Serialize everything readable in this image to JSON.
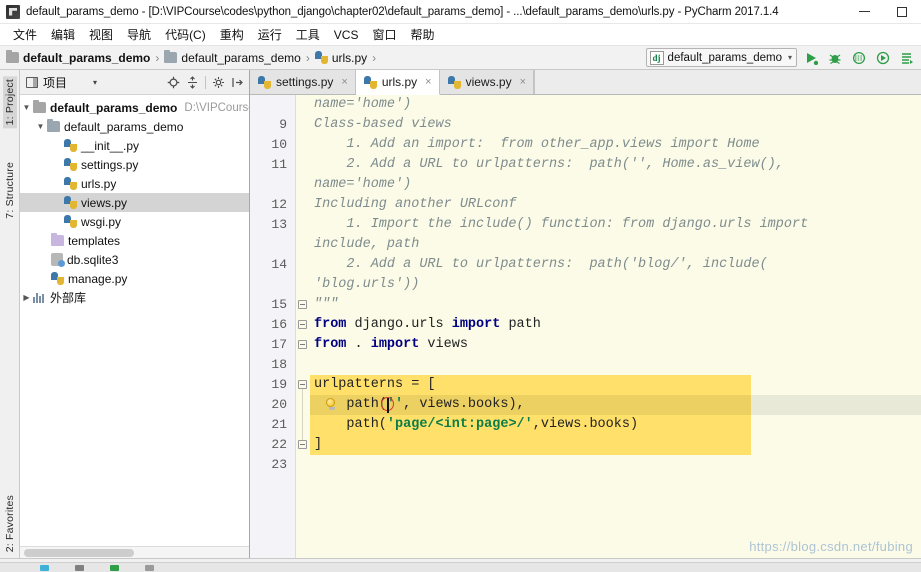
{
  "window": {
    "title": "default_params_demo - [D:\\VIPCourse\\codes\\python_django\\chapter02\\default_params_demo] - ...\\default_params_demo\\urls.py - PyCharm 2017.1.4",
    "app_icon": "pycharm-icon",
    "minimize_label": "–",
    "maximize_label": "□"
  },
  "menubar": {
    "items": [
      {
        "label": "文件",
        "name": "menu-file"
      },
      {
        "label": "编辑",
        "name": "menu-edit"
      },
      {
        "label": "视图",
        "name": "menu-view"
      },
      {
        "label": "导航",
        "name": "menu-navigate"
      },
      {
        "label": "代码(C)",
        "name": "menu-code"
      },
      {
        "label": "重构",
        "name": "menu-refactor"
      },
      {
        "label": "运行",
        "name": "menu-run"
      },
      {
        "label": "工具",
        "name": "menu-tools"
      },
      {
        "label": "VCS",
        "name": "menu-vcs"
      },
      {
        "label": "窗口",
        "name": "menu-window"
      },
      {
        "label": "帮助",
        "name": "menu-help"
      }
    ]
  },
  "breadcrumb": {
    "separator": "›",
    "items": [
      {
        "label": "default_params_demo",
        "icon": "folder-icon",
        "bold": true
      },
      {
        "label": "default_params_demo",
        "icon": "folder-icon",
        "bold": false
      },
      {
        "label": "urls.py",
        "icon": "python-file-icon",
        "bold": false
      }
    ]
  },
  "run_config": {
    "badge": "dj",
    "name": "default_params_demo",
    "caret": "▾",
    "buttons": [
      {
        "name": "run-button",
        "title": "Run"
      },
      {
        "name": "debug-button",
        "title": "Debug"
      },
      {
        "name": "coverage-button",
        "title": "Run with Coverage"
      },
      {
        "name": "profile-button",
        "title": "Profile"
      },
      {
        "name": "attach-button",
        "title": "Attach"
      }
    ]
  },
  "vertical_tabs": [
    {
      "label": "1: Project",
      "name": "vtab-project",
      "active": true
    },
    {
      "label": "7: Structure",
      "name": "vtab-structure",
      "active": false
    },
    {
      "label": "2: Favorites",
      "name": "vtab-favorites",
      "active": false
    }
  ],
  "project_panel": {
    "title": "项目",
    "caret": "▾",
    "tools": [
      {
        "name": "locate-icon",
        "glyph": "⊕"
      },
      {
        "name": "collapse-all-icon",
        "glyph": "⤓"
      },
      {
        "name": "settings-gear-icon",
        "glyph": "⚙"
      },
      {
        "name": "hide-panel-icon",
        "glyph": "⇥"
      }
    ],
    "tree": [
      {
        "name": "tree-item-project-root",
        "label": "default_params_demo",
        "sub": "D:\\VIPCourse",
        "icon": "folder-icon",
        "indent": 0,
        "twisty": "▼",
        "bold": true,
        "selected": false
      },
      {
        "name": "tree-item-package-default-params-demo",
        "label": "default_params_demo",
        "sub": "",
        "icon": "folder-blue-icon",
        "indent": 1,
        "twisty": "▼",
        "bold": false,
        "selected": false
      },
      {
        "name": "tree-item-init-py",
        "label": "__init__.py",
        "sub": "",
        "icon": "python-file-icon",
        "indent": 2,
        "twisty": "",
        "bold": false,
        "selected": false
      },
      {
        "name": "tree-item-settings-py",
        "label": "settings.py",
        "sub": "",
        "icon": "python-file-icon",
        "indent": 2,
        "twisty": "",
        "bold": false,
        "selected": false
      },
      {
        "name": "tree-item-urls-py",
        "label": "urls.py",
        "sub": "",
        "icon": "python-file-icon",
        "indent": 2,
        "twisty": "",
        "bold": false,
        "selected": false
      },
      {
        "name": "tree-item-views-py",
        "label": "views.py",
        "sub": "",
        "icon": "python-file-icon",
        "indent": 2,
        "twisty": "",
        "bold": false,
        "selected": true
      },
      {
        "name": "tree-item-wsgi-py",
        "label": "wsgi.py",
        "sub": "",
        "icon": "python-file-icon",
        "indent": 2,
        "twisty": "",
        "bold": false,
        "selected": false
      },
      {
        "name": "tree-item-templates",
        "label": "templates",
        "sub": "",
        "icon": "folder-violet-icon",
        "indent": 1,
        "twisty": "",
        "bold": false,
        "selected": false
      },
      {
        "name": "tree-item-db-sqlite3",
        "label": "db.sqlite3",
        "sub": "",
        "icon": "database-icon",
        "indent": 1,
        "twisty": "",
        "bold": false,
        "selected": false
      },
      {
        "name": "tree-item-manage-py",
        "label": "manage.py",
        "sub": "",
        "icon": "python-file-icon",
        "indent": 1,
        "twisty": "",
        "bold": false,
        "selected": false
      },
      {
        "name": "tree-item-external-libraries",
        "label": "外部库",
        "sub": "",
        "icon": "library-icon",
        "indent": 0,
        "twisty": "▶",
        "bold": false,
        "selected": false
      }
    ]
  },
  "editor_tabs": [
    {
      "label": "settings.py",
      "name": "editor-tab-settings-py",
      "active": false,
      "close": "×"
    },
    {
      "label": "urls.py",
      "name": "editor-tab-urls-py",
      "active": true,
      "close": "×"
    },
    {
      "label": "views.py",
      "name": "editor-tab-views-py",
      "active": false,
      "close": "×"
    }
  ],
  "editor": {
    "filename": "urls.py",
    "caret_line": 20,
    "highlight_color": "#ffe06a",
    "background_color": "#fbfbe8",
    "line_numbers": [
      "9",
      "10",
      "11",
      "12",
      "13",
      "14",
      "15",
      "16",
      "17",
      "18",
      "19",
      "20",
      "21",
      "22",
      "23"
    ],
    "lines": [
      {
        "n": "",
        "text": "name='home')",
        "style": "doc",
        "wrapped": true
      },
      {
        "n": "9",
        "text": "Class-based views",
        "style": "doc"
      },
      {
        "n": "10",
        "text": "    1. Add an import:  from other_app.views import Home",
        "style": "doc"
      },
      {
        "n": "11",
        "text": "    2. Add a URL to urlpatterns:  path('', Home.as_view(),",
        "style": "doc"
      },
      {
        "n": "",
        "text": "name='home')",
        "style": "doc",
        "wrapped": true
      },
      {
        "n": "12",
        "text": "Including another URLconf",
        "style": "doc"
      },
      {
        "n": "13",
        "text": "    1. Import the include() function: from django.urls import",
        "style": "doc"
      },
      {
        "n": "",
        "text": "include, path",
        "style": "doc",
        "wrapped": true
      },
      {
        "n": "14",
        "text": "    2. Add a URL to urlpatterns:  path('blog/', include(",
        "style": "doc"
      },
      {
        "n": "",
        "text": "'blog.urls'))",
        "style": "doc",
        "wrapped": true
      },
      {
        "n": "15",
        "text": "\"\"\"",
        "style": "doc"
      },
      {
        "n": "16",
        "text": "from django.urls import path",
        "style": "code"
      },
      {
        "n": "17",
        "text": "from . import views",
        "style": "code"
      },
      {
        "n": "18",
        "text": "",
        "style": "code"
      },
      {
        "n": "19",
        "text": "urlpatterns = [",
        "style": "code",
        "highlighted": true
      },
      {
        "n": "20",
        "text": "    path('', views.books),",
        "style": "code",
        "highlighted": true,
        "caret": true,
        "bulb": true
      },
      {
        "n": "21",
        "text": "    path('page/<int:page>/',views.books)",
        "style": "code",
        "highlighted": true
      },
      {
        "n": "22",
        "text": "]",
        "style": "code",
        "highlighted": true
      },
      {
        "n": "23",
        "text": "",
        "style": "code"
      }
    ]
  },
  "watermark": "https://blog.csdn.net/fubing"
}
